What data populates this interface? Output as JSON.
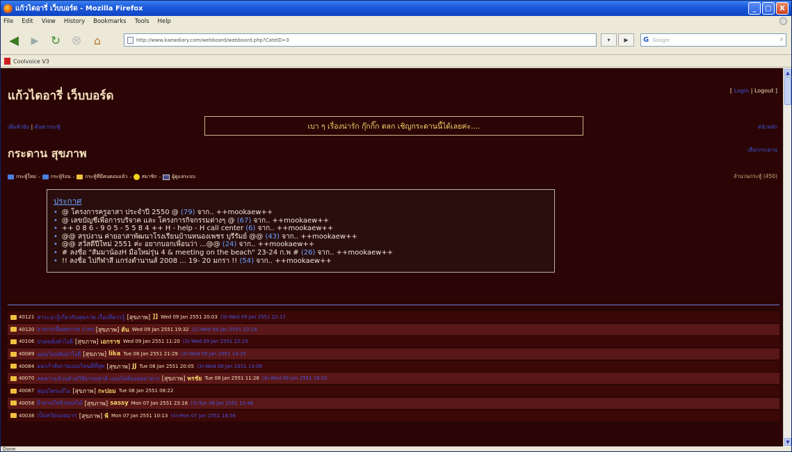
{
  "window": {
    "title": "แก้วไดอารี่ เว็บบอร์ด - Mozilla Firefox",
    "btn_min": "_",
    "btn_max": "□",
    "btn_close": "X"
  },
  "menu": [
    "File",
    "Edit",
    "View",
    "History",
    "Bookmarks",
    "Tools",
    "Help"
  ],
  "nav": {
    "url": "http://www.kaewdiary.com/webboard/webboard.php?CateID=3",
    "search_placeholder": "Google",
    "search_engine_glyph": "G"
  },
  "bookmarks": {
    "item": "Coolvoice V3"
  },
  "status": "Done",
  "page": {
    "site_title": "แก้วไดอารี่ เว็บบอร์ด",
    "login_link": "Login",
    "logout_link": "Logout",
    "marquee": "เบา ๆ เรื่องน่ารัก กุ๊กกิ๊ก ตลก เชิญกระดานนี้ได้เลยค่ะ....",
    "board_title": "กระดาน สุขภาพ",
    "topleft_a": "เพิ่มหัวข้อ",
    "topleft_b": "ค้นหากระทู้",
    "topright_a": "หน้าหลัก",
    "topright_b": "เลือกกระดาน",
    "legend": {
      "new": "กระทู้ใหม่",
      "hot": "กระทู้ร้อน",
      "replied": "กระทู้ที่มีคนตอบแล้ว",
      "member": "สมาชิก",
      "report": "ผู้ดูแลระบบ"
    },
    "thread_count": "จำนวนกระทู้ (450)",
    "announce_heading": "ประกาศ",
    "announcements": [
      {
        "text": "@ โครงการครูอาสา ประจำปี 2550 @",
        "count": "(79)",
        "by": "จาก.. ++mookaew++"
      },
      {
        "text": "@ เลขบัญชีเพื่อการบริจาค และ โครงการกิจกรรมต่างๆ @",
        "count": "(67)",
        "by": "จาก.. ++mookaew++"
      },
      {
        "text": "++ 0 8 6 - 9 0 5 - 5 5 8 4 ++ H - help - H call center",
        "count": "(6)",
        "by": "จาก.. ++mookaew++"
      },
      {
        "text": "@@ สรุปงาน ค่ายอาสาพัฒนาโรงเรียนบ้านหนองเพชร บุรีรัมย์ @@",
        "count": "(43)",
        "by": "จาก.. ++mookaew++"
      },
      {
        "text": "@@ สวัสดีปีใหม่ 2551 ค่ะ อยากบอกเพื่อนว่า ...@@",
        "count": "(24)",
        "by": "จาก.. ++mookaew++"
      },
      {
        "text": "# ลงชื่อ \"สัมมาน้องH มือใหม่รุ่น 4 & meeting on the beach\" 23-24 ก.พ #",
        "count": "(26)",
        "by": "จาก.. ++mookaew++"
      },
      {
        "text": "!! ลงชื่อ ไปกีฬาสี แกร่งตำนานส์ 2008 ... 19- 20 มกรา !!",
        "count": "(54)",
        "by": "จาก.. ++mookaew++"
      }
    ],
    "topics": [
      {
        "id": "40121",
        "title": "สาระน่ารู้เกี่ยวกับสุขภาพ เรื่องที่ควรรู้",
        "cat": "[สุขภาพ]",
        "author": "]]",
        "date": "Wed 09 Jan 2551 20:03",
        "last": "(3)-Wed 09 Jan 2551 22:17"
      },
      {
        "id": "40120",
        "title": "อาหารเพื่อสุขภาพ ง่ายๆ",
        "cat": "[สุขภาพ]",
        "author": "ต้น",
        "date": "Wed 09 Jan 2551 19:32",
        "last": "(2)-Wed 09 Jan 2551 22:18"
      },
      {
        "id": "40106",
        "title": "ปวดหลังทำไงดี",
        "cat": "[สุขภาพ]",
        "author": "เอกราช",
        "date": "Wed 09 Jan 2551 11:20",
        "last": "(3)-Wed 09 Jan 2551 22:25"
      },
      {
        "id": "40089",
        "title": "นอนไม่หลับทำไงดี",
        "cat": "[สุขภาพ]",
        "author": "lika",
        "date": "Tue 08 Jan 2551 21:29",
        "last": "(2)-Wed 09 Jan 2551 14:15"
      },
      {
        "id": "40084",
        "title": "ออกกำลังกายแบบไหนดีที่สุด",
        "cat": "[สุขภาพ]",
        "author": "JJ",
        "date": "Tue 08 Jan 2551 20:05",
        "last": "(3)-Wed 09 Jan 2551 14:09"
      },
      {
        "id": "40070",
        "title": "ลดความอ้วนด้วยวิธีธรรมชาติ แบบไม่ต้องอดอาหาร",
        "cat": "[สุขภาพ]",
        "author": "พรชัย",
        "date": "Tue 08 Jan 2551 11:28",
        "last": "(4)-Wed 09 Jan 2551 18:51"
      },
      {
        "id": "40067",
        "title": "สมุนไพรแก้ไอ",
        "cat": "[สุขภาพ]",
        "author": "กะปอม",
        "date": "Tue 08 Jan 2551 08:22",
        "last": ""
      },
      {
        "id": "40058",
        "title": "ผิวสวยใสด้วยผลไม้",
        "cat": "[สุขภาพ]",
        "author": "sassy",
        "date": "Mon 07 Jan 2551 23:16",
        "last": "(3)-Tue 08 Jan 2551 13:46"
      },
      {
        "id": "40038",
        "title": "เป็นหวัดบ่อยมาก",
        "cat": "[สุขภาพ]",
        "author": "พี",
        "date": "Mon 07 Jan 2551 10:13",
        "last": "(4)-Mon 07 Jan 2551 18:56"
      }
    ]
  }
}
